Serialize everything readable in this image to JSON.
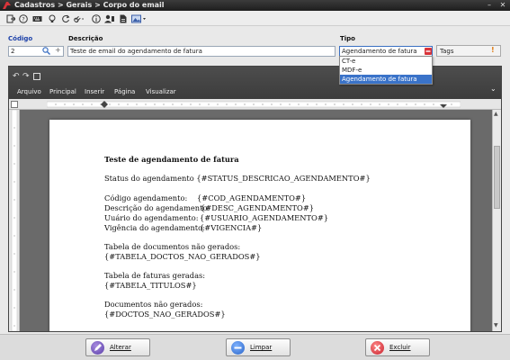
{
  "window": {
    "title": "Cadastros > Gerais > Corpo do email"
  },
  "form": {
    "codigo_label": "Código",
    "codigo_value": "2",
    "descricao_label": "Descrição",
    "descricao_value": "Teste de email do agendamento de fatura",
    "tipo_label": "Tipo",
    "tipo_value": "Agendamento de fatura",
    "tipo_options": [
      "CT-e",
      "MDF-e",
      "Agendamento de fatura"
    ],
    "tags_label": "Tags"
  },
  "ribbon": {
    "tabs": [
      "Arquivo",
      "Principal",
      "Inserir",
      "Página",
      "Visualizar"
    ]
  },
  "document": {
    "lines": [
      "Teste de agendamento de fatura",
      "Status do agendamento {#STATUS_DESCRICAO_AGENDAMENTO#}",
      "Código agendamento:",
      "{#COD_AGENDAMENTO#}",
      "Descrição do agendamento:",
      "{#DESC_AGENDAMENTO#}",
      "Uuário do agendamento:",
      "{#USUARIO_AGENDAMENTO#}",
      "Vigência do agendamento:",
      "{#VIGENCIA#}",
      "Tabela de documentos não gerados:",
      "{#TABELA_DOCTOS_NAO_GERADOS#}",
      "Tabela de faturas geradas:",
      "{#TABELA_TITULOS#}",
      "Documentos não gerados:",
      "{#DOCTOS_NAO_GERADOS#}"
    ]
  },
  "buttons": {
    "alterar": "Alterar",
    "limpar": "Limpar",
    "excluir": "Excluir"
  },
  "colors": {
    "accent_blue": "#1a3fa8",
    "selection": "#3a73c9",
    "editor_dark": "#4a4a4a"
  }
}
